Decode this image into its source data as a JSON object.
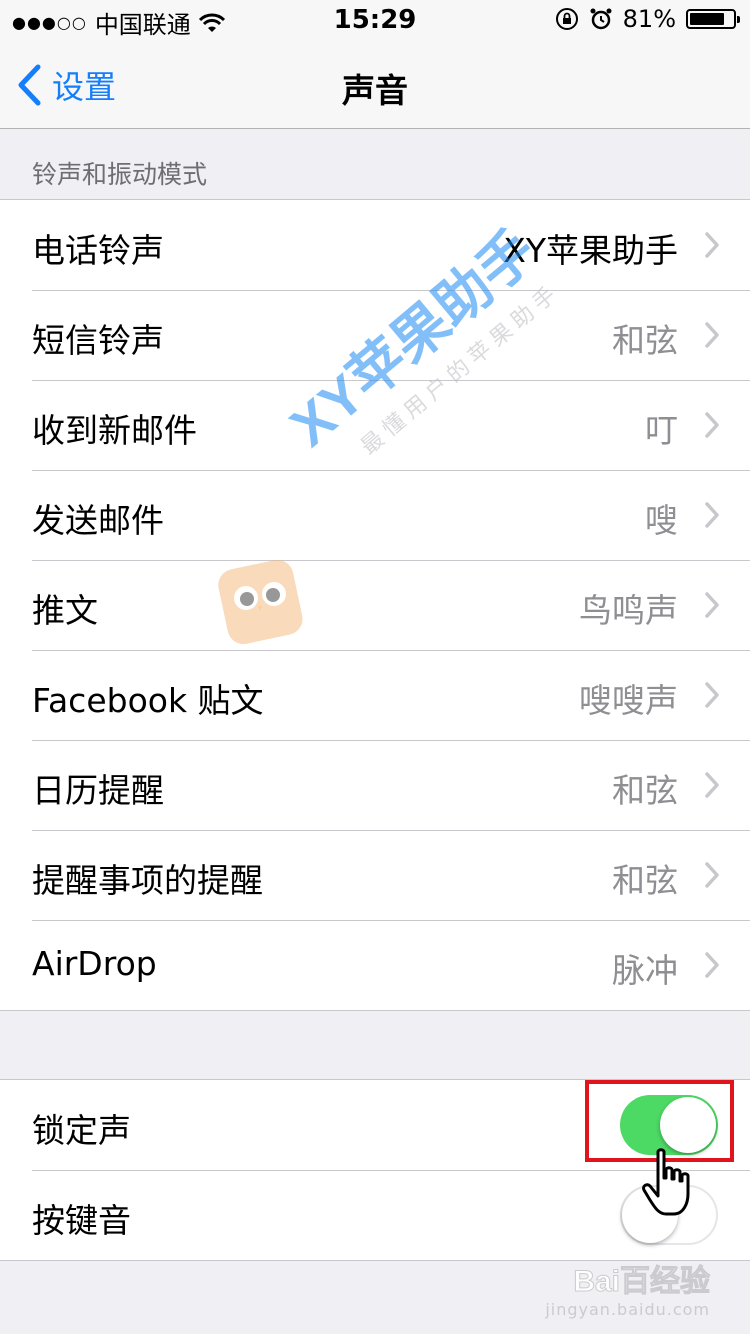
{
  "status_bar": {
    "signal": "●●●○○",
    "carrier": "中国联通",
    "time": "15:29",
    "battery_text": "81%",
    "battery_level": 0.81
  },
  "nav": {
    "back_label": "设置",
    "title": "声音"
  },
  "section": {
    "header": "铃声和振动模式"
  },
  "sound_rows": [
    {
      "label": "电话铃声",
      "value": "XY苹果助手"
    },
    {
      "label": "短信铃声",
      "value": "和弦"
    },
    {
      "label": "收到新邮件",
      "value": "叮"
    },
    {
      "label": "发送邮件",
      "value": "嗖"
    },
    {
      "label": "推文",
      "value": "鸟鸣声"
    },
    {
      "label": "Facebook 贴文",
      "value": "嗖嗖声"
    },
    {
      "label": "日历提醒",
      "value": "和弦"
    },
    {
      "label": "提醒事项的提醒",
      "value": "和弦"
    },
    {
      "label": "AirDrop",
      "value": "脉冲"
    }
  ],
  "toggles": [
    {
      "label": "锁定声",
      "on": true
    },
    {
      "label": "按键音",
      "on": false
    }
  ],
  "colors": {
    "accent": "#147efb",
    "toggle_on": "#4cd964",
    "highlight": "#e0141c"
  },
  "watermark": {
    "main": "XY苹果助手",
    "sub": "最懂用户的苹果助手",
    "baidu_main": "Bai百经验",
    "baidu_sub": "jingyan.baidu.com"
  }
}
